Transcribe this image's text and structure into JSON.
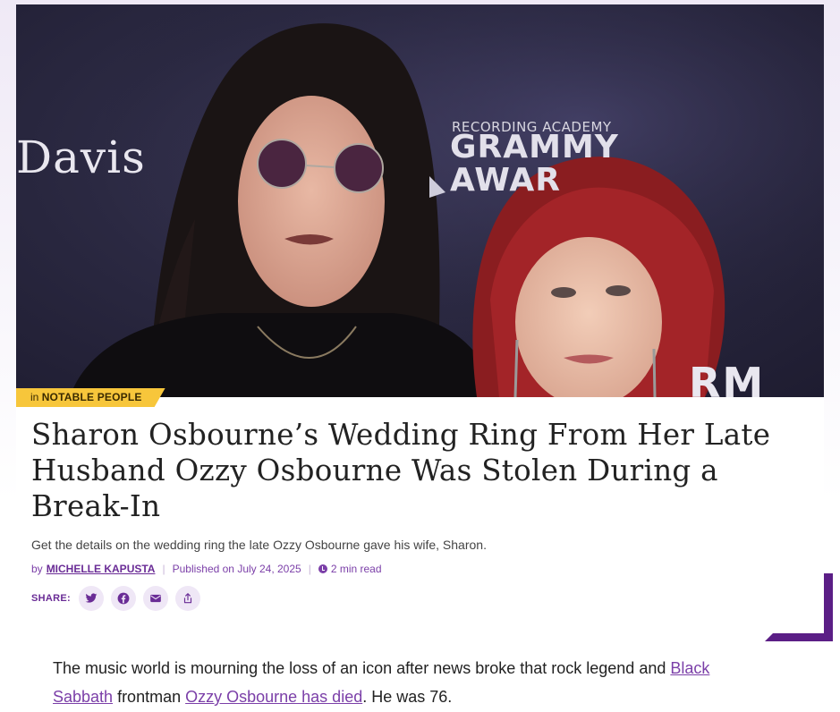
{
  "hero": {
    "alt_subjects": "photo",
    "backdrop": {
      "davis": "Davis",
      "academy": "RECORDING ACADEMY",
      "grammy": "GRAMMY",
      "awards": "AWAR",
      "rm": "RM"
    }
  },
  "category": {
    "prefix": "in",
    "name": "Notable People",
    "color": "#f7c63b"
  },
  "article": {
    "headline": "Sharon Osbourne’s Wedding Ring From Her Late Husband Ozzy Osbourne Was Stolen During a Break-In",
    "dek": "Get the details on the wedding ring the late Ozzy Osbourne gave his wife, Sharon.",
    "byline": {
      "by": "by",
      "author": "Michelle Kapusta",
      "published": "Published on July 24, 2025",
      "read_time": "2 min read"
    },
    "share": {
      "label": "SHARE:",
      "buttons": [
        "twitter-icon",
        "facebook-icon",
        "email-icon",
        "share-icon"
      ]
    },
    "body": {
      "text_1": "The music world is mourning the loss of an icon after news broke that rock legend and ",
      "link_1": "Black Sabbath",
      "text_2": " frontman ",
      "link_2": "Ozzy Osbourne has died",
      "text_3": ". He was 76."
    }
  },
  "colors": {
    "accent": "#7b3fa8",
    "accent_dark": "#6a2c96",
    "corner": "#5b1e86"
  }
}
